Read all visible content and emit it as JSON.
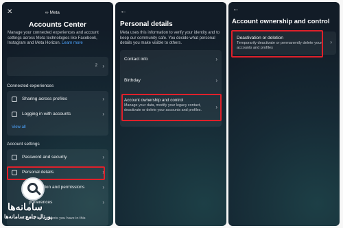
{
  "panel1": {
    "close_icon": "✕",
    "brand": "∞ Meta",
    "title": "Accounts Center",
    "description": "Manage your connected experiences and account settings across Meta technologies like Facebook, Instagram and Meta Horizon.",
    "learn_more": "Learn more",
    "profiles_count": "2",
    "connected_heading": "Connected experiences",
    "sharing": "Sharing across profiles",
    "logging_in": "Logging in with accounts",
    "view_all": "View all",
    "settings_heading": "Account settings",
    "password": "Password and security",
    "personal_details": "Personal details",
    "information": "information and permissions",
    "preferences": "preferences",
    "review": "Review the accounts you have in this"
  },
  "panel2": {
    "back_icon": "←",
    "title": "Personal details",
    "description": "Meta uses this information to verify your identity and to keep our community safe. You decide what personal details you make visible to others.",
    "contact_info": "Contact info",
    "birthday": "Birthday",
    "ownership_title": "Account ownership and control",
    "ownership_desc": "Manage your data, modify your legacy contact, deactivate or delete your accounts and profiles."
  },
  "panel3": {
    "back_icon": "←",
    "title": "Account ownership and control",
    "deact_title": "Deactivation or deletion",
    "deact_desc": "Temporarily deactivate or permanently delete your accounts and profiles"
  },
  "watermark": {
    "line1": "سامانه‌ها",
    "line2": "پورتال جامع سامانه‌ها"
  },
  "colors": {
    "highlight": "#e0202a",
    "link": "#4ea4ff"
  }
}
